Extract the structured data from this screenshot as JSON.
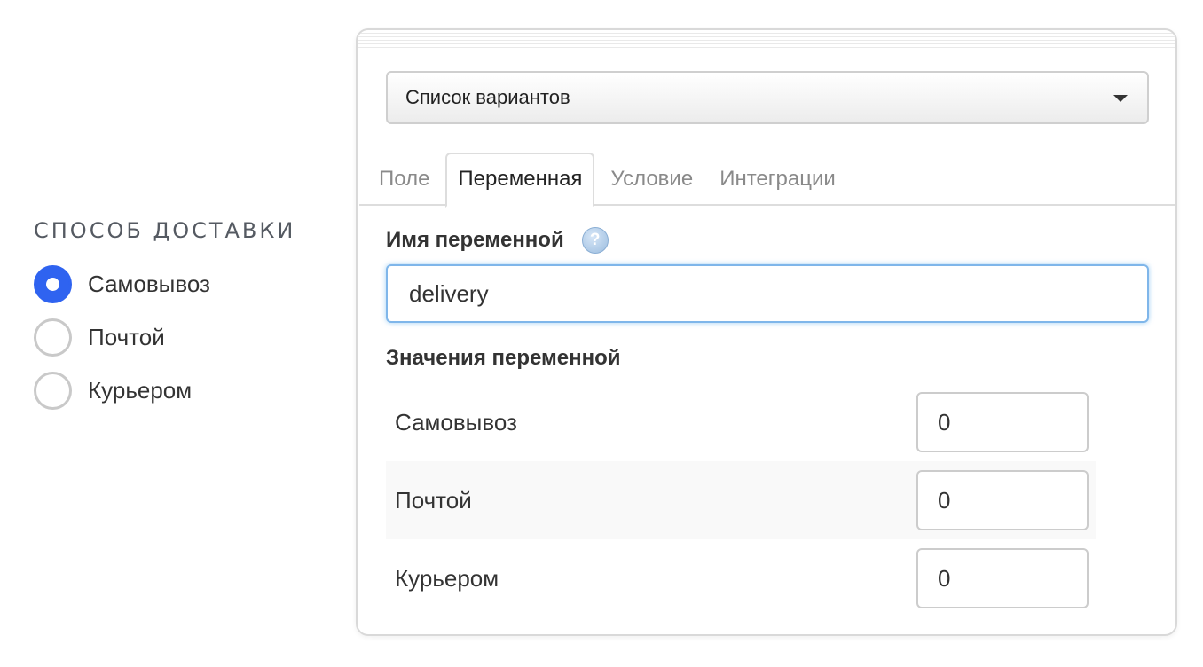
{
  "preview": {
    "title": "СПОСОБ ДОСТАВКИ",
    "options": [
      {
        "label": "Самовывоз",
        "checked": true
      },
      {
        "label": "Почтой",
        "checked": false
      },
      {
        "label": "Курьером",
        "checked": false
      }
    ],
    "accent_color": "#2f63f0"
  },
  "panel": {
    "type_select": {
      "value": "Список вариантов"
    },
    "tabs": [
      {
        "label": "Поле",
        "active": false
      },
      {
        "label": "Переменная",
        "active": true
      },
      {
        "label": "Условие",
        "active": false
      },
      {
        "label": "Интеграции",
        "active": false
      }
    ],
    "variable_name_label": "Имя переменной",
    "help_icon_glyph": "?",
    "variable_name_value": "delivery",
    "variable_values_label": "Значения переменной",
    "values": [
      {
        "label": "Самовывоз",
        "value": "0"
      },
      {
        "label": "Почтой",
        "value": "0"
      },
      {
        "label": "Курьером",
        "value": "0"
      }
    ]
  }
}
